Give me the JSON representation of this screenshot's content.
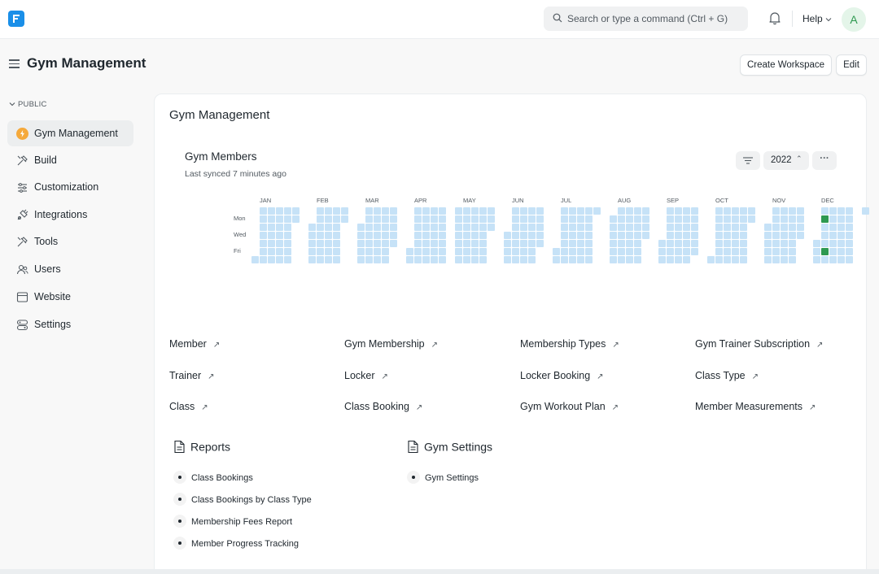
{
  "navbar": {
    "search_placeholder": "Search or type a command (Ctrl + G)",
    "help_label": "Help",
    "avatar_initial": "A"
  },
  "page": {
    "title": "Gym Management",
    "create_workspace_label": "Create Workspace",
    "edit_label": "Edit"
  },
  "sidebar": {
    "section_label": "PUBLIC",
    "items": [
      {
        "label": "Gym Management",
        "icon": "bolt-icon",
        "active": true
      },
      {
        "label": "Build",
        "icon": "tools-icon"
      },
      {
        "label": "Customization",
        "icon": "sliders-icon"
      },
      {
        "label": "Integrations",
        "icon": "plug-icon"
      },
      {
        "label": "Tools",
        "icon": "tools-icon"
      },
      {
        "label": "Users",
        "icon": "users-icon"
      },
      {
        "label": "Website",
        "icon": "browser-icon"
      },
      {
        "label": "Settings",
        "icon": "settings-icon"
      }
    ]
  },
  "workspace": {
    "title": "Gym Management"
  },
  "chart": {
    "title": "Gym Members",
    "subtitle": "Last synced 7 minutes ago",
    "year": "2022",
    "more": "···"
  },
  "chart_data": {
    "type": "heatmap",
    "title": "Gym Members",
    "year": 2022,
    "months": [
      "JAN",
      "FEB",
      "MAR",
      "APR",
      "MAY",
      "JUN",
      "JUL",
      "AUG",
      "SEP",
      "OCT",
      "NOV",
      "DEC"
    ],
    "day_labels": [
      "Mon",
      "Wed",
      "Fri"
    ],
    "nonzero_days": [
      {
        "date": "2022-12-05",
        "level": "high"
      },
      {
        "date": "2022-12-09",
        "level": "high"
      }
    ],
    "colors": {
      "empty": "#c6e2f7",
      "high": "#2e9950"
    }
  },
  "shortcuts": [
    "Member",
    "Gym Membership",
    "Membership Types",
    "Gym Trainer Subscription",
    "Trainer",
    "Locker",
    "Locker Booking",
    "Class Type",
    "Class",
    "Class Booking",
    "Gym Workout Plan",
    "Member Measurements"
  ],
  "cards": [
    {
      "title": "Reports",
      "items": [
        "Class Bookings",
        "Class Bookings by Class Type",
        "Membership Fees Report",
        "Member Progress Tracking"
      ]
    },
    {
      "title": "Gym Settings",
      "items": [
        "Gym Settings"
      ]
    }
  ],
  "colors": {
    "accent": "#1a8fe8",
    "heat_empty": "#c6e2f7",
    "heat_high": "#2e9950"
  }
}
